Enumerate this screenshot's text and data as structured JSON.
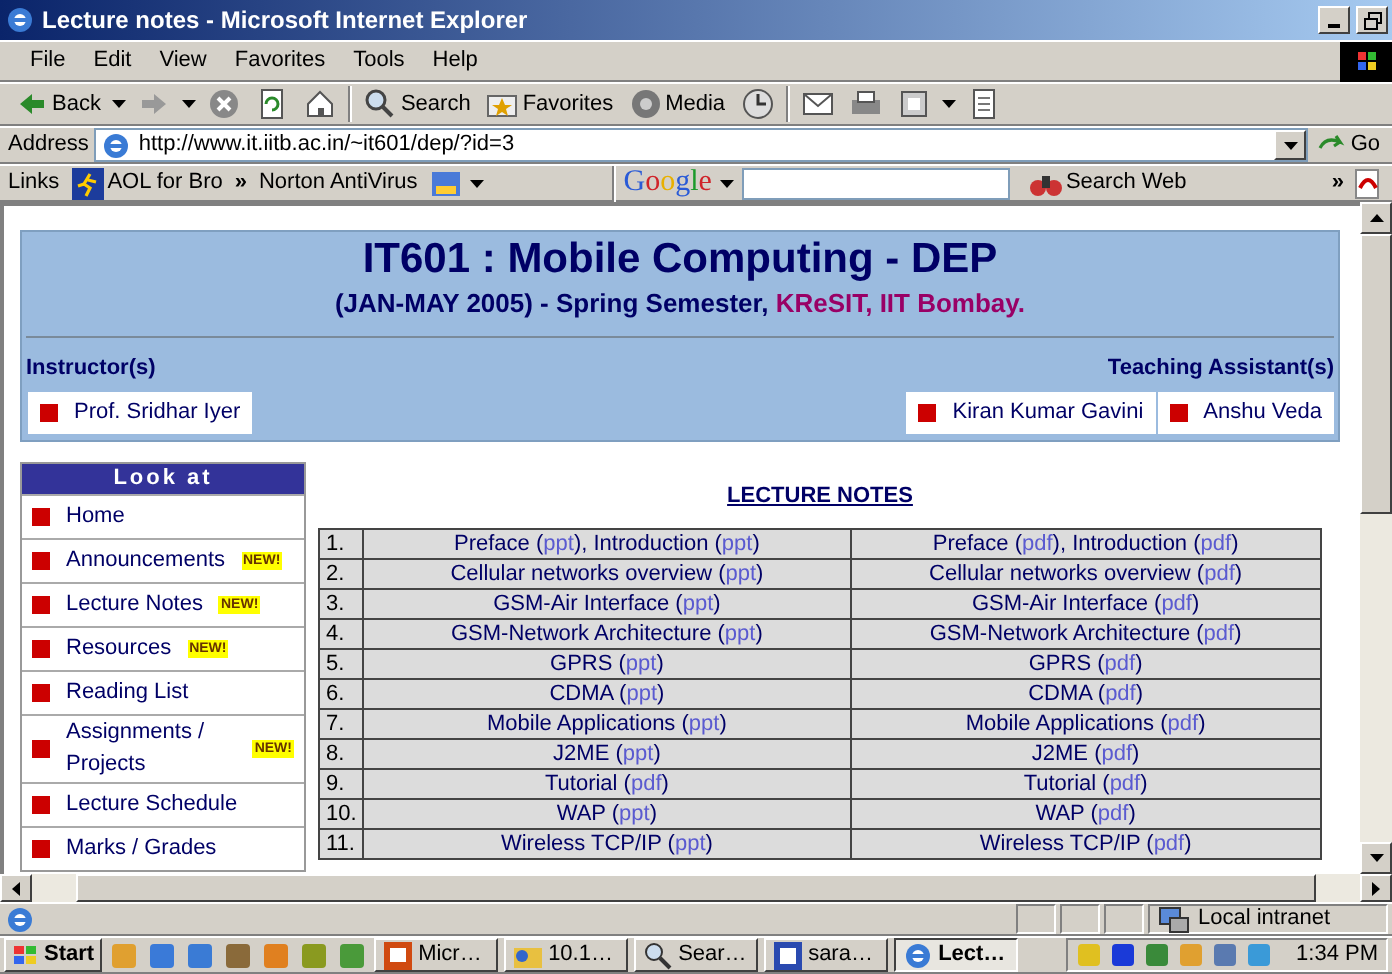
{
  "window": {
    "title": "Lecture notes - Microsoft Internet Explorer"
  },
  "menu": [
    "File",
    "Edit",
    "View",
    "Favorites",
    "Tools",
    "Help"
  ],
  "toolbar": [
    {
      "kind": "back",
      "label": "Back"
    },
    {
      "kind": "forward"
    },
    {
      "kind": "stop"
    },
    {
      "kind": "refresh"
    },
    {
      "kind": "home"
    },
    {
      "kind": "search",
      "label": "Search"
    },
    {
      "kind": "favorites",
      "label": "Favorites"
    },
    {
      "kind": "media",
      "label": "Media"
    },
    {
      "kind": "history"
    },
    {
      "kind": "mail"
    },
    {
      "kind": "print"
    },
    {
      "kind": "edit"
    },
    {
      "kind": "discuss"
    }
  ],
  "address": {
    "label": "Address",
    "url": "http://www.it.iitb.ac.in/~it601/dep/?id=3",
    "go": "Go"
  },
  "links_bar": {
    "label": "Links",
    "aol": "AOL for Bro",
    "chevron_1": "»",
    "norton": "Norton AntiVirus",
    "google_logo": "Google",
    "search_button": "Search Web",
    "chevron_2": "»"
  },
  "page": {
    "title": "IT601 : Mobile Computing - DEP",
    "subtitle": "(JAN-MAY 2005) - Spring Semester, ",
    "institute": "KReSIT, IIT Bombay.",
    "instructors_label": "Instructor(s)",
    "instructors": [
      "Prof. Sridhar Iyer"
    ],
    "assistants_label": "Teaching Assistant(s)",
    "assistants": [
      "Kiran Kumar Gavini",
      "Anshu Veda"
    ],
    "sidebar": {
      "title": "Look at",
      "items": [
        {
          "label": "Home"
        },
        {
          "label": "Announcements",
          "badge": "NEW!"
        },
        {
          "label": "Lecture Notes",
          "badge": "NEW!"
        },
        {
          "label": "Resources",
          "badge": "NEW!"
        },
        {
          "label": "Reading List"
        },
        {
          "label": "Assignments / Projects",
          "badge": "NEW!"
        },
        {
          "label": "Lecture Schedule"
        },
        {
          "label": "Marks / Grades"
        }
      ]
    },
    "notes_title": "LECTURE NOTES",
    "rows": [
      {
        "number": "1.",
        "ppt": [
          {
            "kind": "text",
            "text": "Preface ("
          },
          {
            "kind": "link",
            "text": "ppt"
          },
          {
            "kind": "text",
            "text": "), Introduction ("
          },
          {
            "kind": "link",
            "text": "ppt"
          },
          {
            "kind": "text",
            "text": ")"
          }
        ],
        "pdf": [
          {
            "kind": "text",
            "text": "Preface ("
          },
          {
            "kind": "link",
            "text": "pdf"
          },
          {
            "kind": "text",
            "text": "), Introduction ("
          },
          {
            "kind": "link",
            "text": "pdf"
          },
          {
            "kind": "text",
            "text": ")"
          }
        ]
      },
      {
        "number": "2.",
        "ppt": [
          {
            "kind": "text",
            "text": "Cellular networks overview ("
          },
          {
            "kind": "link",
            "text": "ppt"
          },
          {
            "kind": "text",
            "text": ")"
          }
        ],
        "pdf": [
          {
            "kind": "text",
            "text": "Cellular networks overview ("
          },
          {
            "kind": "link",
            "text": "pdf"
          },
          {
            "kind": "text",
            "text": ")"
          }
        ]
      },
      {
        "number": "3.",
        "ppt": [
          {
            "kind": "text",
            "text": "GSM-Air Interface ("
          },
          {
            "kind": "link",
            "text": "ppt"
          },
          {
            "kind": "text",
            "text": ")"
          }
        ],
        "pdf": [
          {
            "kind": "text",
            "text": "GSM-Air Interface ("
          },
          {
            "kind": "link",
            "text": "pdf"
          },
          {
            "kind": "text",
            "text": ")"
          }
        ]
      },
      {
        "number": "4.",
        "ppt": [
          {
            "kind": "text",
            "text": "GSM-Network Architecture ("
          },
          {
            "kind": "link",
            "text": "ppt"
          },
          {
            "kind": "text",
            "text": ")"
          }
        ],
        "pdf": [
          {
            "kind": "text",
            "text": "GSM-Network Architecture ("
          },
          {
            "kind": "link",
            "text": "pdf"
          },
          {
            "kind": "text",
            "text": ")"
          }
        ]
      },
      {
        "number": "5.",
        "ppt": [
          {
            "kind": "text",
            "text": "GPRS ("
          },
          {
            "kind": "link",
            "text": "ppt"
          },
          {
            "kind": "text",
            "text": ")"
          }
        ],
        "pdf": [
          {
            "kind": "text",
            "text": "GPRS ("
          },
          {
            "kind": "link",
            "text": "pdf"
          },
          {
            "kind": "text",
            "text": ")"
          }
        ]
      },
      {
        "number": "6.",
        "ppt": [
          {
            "kind": "text",
            "text": "CDMA ("
          },
          {
            "kind": "link",
            "text": "ppt"
          },
          {
            "kind": "text",
            "text": ")"
          }
        ],
        "pdf": [
          {
            "kind": "text",
            "text": "CDMA ("
          },
          {
            "kind": "link",
            "text": "pdf"
          },
          {
            "kind": "text",
            "text": ")"
          }
        ]
      },
      {
        "number": "7.",
        "ppt": [
          {
            "kind": "text",
            "text": "Mobile Applications ("
          },
          {
            "kind": "link",
            "text": "ppt"
          },
          {
            "kind": "text",
            "text": ")"
          }
        ],
        "pdf": [
          {
            "kind": "text",
            "text": "Mobile Applications ("
          },
          {
            "kind": "link",
            "text": "pdf"
          },
          {
            "kind": "text",
            "text": ")"
          }
        ]
      },
      {
        "number": "8.",
        "ppt": [
          {
            "kind": "text",
            "text": "J2ME ("
          },
          {
            "kind": "link",
            "text": "ppt"
          },
          {
            "kind": "text",
            "text": ")"
          }
        ],
        "pdf": [
          {
            "kind": "text",
            "text": "J2ME ("
          },
          {
            "kind": "link",
            "text": "pdf"
          },
          {
            "kind": "text",
            "text": ")"
          }
        ]
      },
      {
        "number": "9.",
        "ppt": [
          {
            "kind": "text",
            "text": "Tutorial ("
          },
          {
            "kind": "link",
            "text": "pdf"
          },
          {
            "kind": "text",
            "text": ")"
          }
        ],
        "pdf": [
          {
            "kind": "text",
            "text": "Tutorial ("
          },
          {
            "kind": "link",
            "text": "pdf"
          },
          {
            "kind": "text",
            "text": ")"
          }
        ]
      },
      {
        "number": "10.",
        "ppt": [
          {
            "kind": "text",
            "text": "WAP ("
          },
          {
            "kind": "link",
            "text": "ppt"
          },
          {
            "kind": "text",
            "text": ")"
          }
        ],
        "pdf": [
          {
            "kind": "text",
            "text": "WAP ("
          },
          {
            "kind": "link",
            "text": "pdf"
          },
          {
            "kind": "text",
            "text": ")"
          }
        ]
      },
      {
        "number": "11.",
        "ppt": [
          {
            "kind": "text",
            "text": "Wireless TCP/IP ("
          },
          {
            "kind": "link",
            "text": "ppt"
          },
          {
            "kind": "text",
            "text": ")"
          }
        ],
        "pdf": [
          {
            "kind": "text",
            "text": "Wireless TCP/IP ("
          },
          {
            "kind": "link",
            "text": "pdf"
          },
          {
            "kind": "text",
            "text": ")"
          }
        ]
      }
    ]
  },
  "status_bar": {
    "zone": "Local intranet"
  },
  "taskbar": {
    "start": "Start",
    "tasks": [
      {
        "kind": "presentation",
        "label": "Micr…",
        "selected": false
      },
      {
        "kind": "folder",
        "label": "10.1…",
        "selected": false
      },
      {
        "kind": "search",
        "label": "Sear…",
        "selected": false
      },
      {
        "kind": "document",
        "label": "sara…",
        "selected": false
      },
      {
        "kind": "browser",
        "label": "Lect…",
        "selected": true
      }
    ],
    "clock": "1:34 PM"
  }
}
